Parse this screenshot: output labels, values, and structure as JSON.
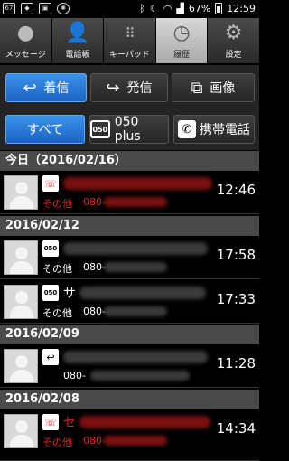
{
  "status": {
    "left_icons": [
      "67",
      "notification-icon",
      "image-icon",
      "settings-icon"
    ],
    "battery_pct": "67%",
    "clock": "12:59"
  },
  "tabs": [
    {
      "label": "メッセージ",
      "icon": "chat-bubble-icon",
      "active": false
    },
    {
      "label": "電話帳",
      "icon": "person-icon",
      "active": false
    },
    {
      "label": "キーパッド",
      "icon": "keypad-icon",
      "active": false
    },
    {
      "label": "履歴",
      "icon": "clock-icon",
      "active": true
    },
    {
      "label": "設定",
      "icon": "gear-icon",
      "active": false
    }
  ],
  "filters_row1": {
    "incoming": "着信",
    "outgoing": "発信",
    "image": "画像"
  },
  "filters_row2": {
    "all": "すべて",
    "plus050": "050 plus",
    "mobile": "携帯電話"
  },
  "sections": [
    {
      "title": "今日（2016/02/16）"
    },
    {
      "title": "2016/02/12"
    },
    {
      "title": "2016/02/09"
    },
    {
      "title": "2016/02/08"
    }
  ],
  "entries": [
    {
      "type": "missed",
      "name": "",
      "label": "その他",
      "number": "080-",
      "time": "12:46",
      "color": "#e02020"
    },
    {
      "type": "050",
      "name": "",
      "label": "その他",
      "number": "080-",
      "time": "17:58",
      "color": "#ffffff"
    },
    {
      "type": "050",
      "name": "サ",
      "label": "その他",
      "number": "080-",
      "time": "17:33",
      "color": "#ffffff"
    },
    {
      "type": "incoming",
      "name": "",
      "label": "",
      "number": "080-",
      "time": "11:28",
      "color": "#ffffff"
    },
    {
      "type": "missed",
      "name": "セ",
      "label": "その他",
      "number": "080-",
      "time": "14:34",
      "color": "#e02020"
    }
  ],
  "colors": {
    "selected_blue": "#1d62c5",
    "missed_red": "#e02020",
    "section_bg": "#4a4a4a"
  }
}
